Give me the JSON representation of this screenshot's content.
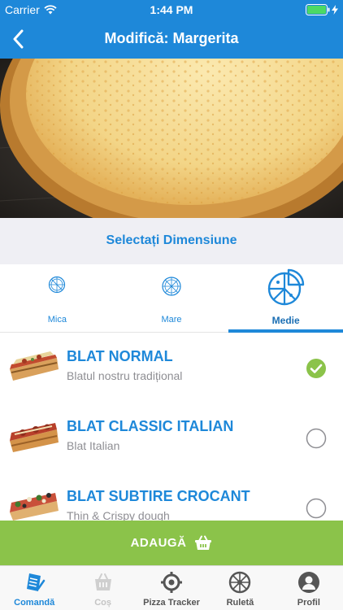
{
  "status_bar": {
    "carrier": "Carrier",
    "time": "1:44 PM",
    "icons": [
      "wifi-icon",
      "battery-icon",
      "charging-icon"
    ]
  },
  "nav": {
    "title": "Modifică: Margerita",
    "back_icon": "chevron-left-icon"
  },
  "hero": {
    "image": "pizza-margherita-photo"
  },
  "size_section": {
    "title": "Selectați Dimensiune",
    "tabs": [
      {
        "label": "Mica",
        "icon": "pizza-small-icon",
        "selected": false
      },
      {
        "label": "Mare",
        "icon": "pizza-large-icon",
        "selected": false
      },
      {
        "label": "Medie",
        "icon": "pizza-medium-icon",
        "selected": true
      }
    ]
  },
  "crusts": [
    {
      "name": "BLAT NORMAL",
      "description": "Blatul nostru tradițional",
      "image": "crust-normal-thumb",
      "selected": true
    },
    {
      "name": "BLAT CLASSIC ITALIAN",
      "description": "Blat Italian",
      "image": "crust-classic-italian-thumb",
      "selected": false
    },
    {
      "name": "BLAT SUBTIRE CROCANT",
      "description": "Thin & Crispy dough",
      "image": "crust-thin-crispy-thumb",
      "selected": false
    }
  ],
  "add_button": {
    "label": "ADAUGĂ",
    "icon": "basket-icon"
  },
  "tab_bar": {
    "items": [
      {
        "label": "Comandă",
        "icon": "order-icon",
        "active": true
      },
      {
        "label": "Coș",
        "icon": "cart-icon",
        "disabled": true
      },
      {
        "label": "Pizza Tracker",
        "icon": "tracker-icon"
      },
      {
        "label": "Ruletă",
        "icon": "roulette-icon"
      },
      {
        "label": "Profil",
        "icon": "profile-icon"
      }
    ]
  },
  "colors": {
    "primary": "#1e88d9",
    "accent_green": "#8bc34a",
    "background_gray": "#efeff4",
    "muted_text": "#8e8e93"
  }
}
